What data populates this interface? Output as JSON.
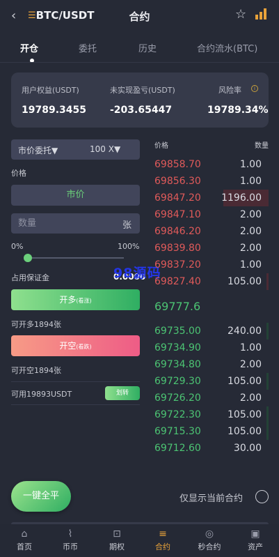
{
  "header": {
    "pair": "BTC/USDT",
    "title": "合约"
  },
  "tabs": [
    "开仓",
    "委托",
    "历史",
    "合约流水(BTC)"
  ],
  "account": {
    "equity_label": "用户权益(USDT)",
    "equity_value": "19789.3455",
    "unrealized_label": "未实现盈亏(USDT)",
    "unrealized_value": "-203.65447",
    "risk_label": "风险率",
    "risk_value": "19789.34%"
  },
  "form": {
    "order_type": "市价委托▼",
    "leverage": "100 X▼",
    "price_label": "价格",
    "market_label": "市价",
    "quantity_placeholder": "数量",
    "quantity_unit": "张",
    "slider_min": "0%",
    "slider_max": "100%",
    "slider_level": 0,
    "margin_label": "占用保证金",
    "margin_value": "0.0000",
    "long_button": "开多",
    "long_button_tag": "(看涨)",
    "long_available": "可开多1894张",
    "short_button": "开空",
    "short_button_tag": "(看跌)",
    "short_available": "可开空1894张",
    "available_balance": "可用19893USDT",
    "transfer_button": "划转"
  },
  "watermark": "98源码",
  "orderbook": {
    "price_header": "价格",
    "qty_header": "数量",
    "asks": [
      {
        "price": "69858.70",
        "qty": "1.00",
        "depth": 0
      },
      {
        "price": "69856.30",
        "qty": "1.00",
        "depth": 0
      },
      {
        "price": "69847.20",
        "qty": "1196.00",
        "depth": 0.38
      },
      {
        "price": "69847.10",
        "qty": "2.00",
        "depth": 0
      },
      {
        "price": "69846.20",
        "qty": "2.00",
        "depth": 0
      },
      {
        "price": "69839.80",
        "qty": "2.00",
        "depth": 0
      },
      {
        "price": "69837.20",
        "qty": "1.00",
        "depth": 0
      },
      {
        "price": "69827.40",
        "qty": "105.00",
        "depth": 0.02
      }
    ],
    "last_price": "69777.6",
    "bids": [
      {
        "price": "69735.00",
        "qty": "240.00",
        "depth": 0.02
      },
      {
        "price": "69734.90",
        "qty": "1.00",
        "depth": 0
      },
      {
        "price": "69734.80",
        "qty": "2.00",
        "depth": 0
      },
      {
        "price": "69729.30",
        "qty": "105.00",
        "depth": 0.02
      },
      {
        "price": "69726.20",
        "qty": "2.00",
        "depth": 0
      },
      {
        "price": "69722.30",
        "qty": "105.00",
        "depth": 0.02
      },
      {
        "price": "69715.30",
        "qty": "105.00",
        "depth": 0.02
      },
      {
        "price": "69712.60",
        "qty": "30.00",
        "depth": 0
      }
    ]
  },
  "bottom": {
    "close_all": "一键全平",
    "only_current": "仅显示当前合约"
  },
  "nav": [
    {
      "label": "首页",
      "icon": "home-icon"
    },
    {
      "label": "币币",
      "icon": "chart-line-icon"
    },
    {
      "label": "期权",
      "icon": "gift-icon"
    },
    {
      "label": "合约",
      "icon": "contract-icon",
      "active": true
    },
    {
      "label": "秒合约",
      "icon": "target-icon"
    },
    {
      "label": "资产",
      "icon": "wallet-icon"
    }
  ],
  "colors": {
    "background": "#262a36",
    "accent": "#e8a23a",
    "up": "#4cc473",
    "down": "#e05a5a"
  }
}
